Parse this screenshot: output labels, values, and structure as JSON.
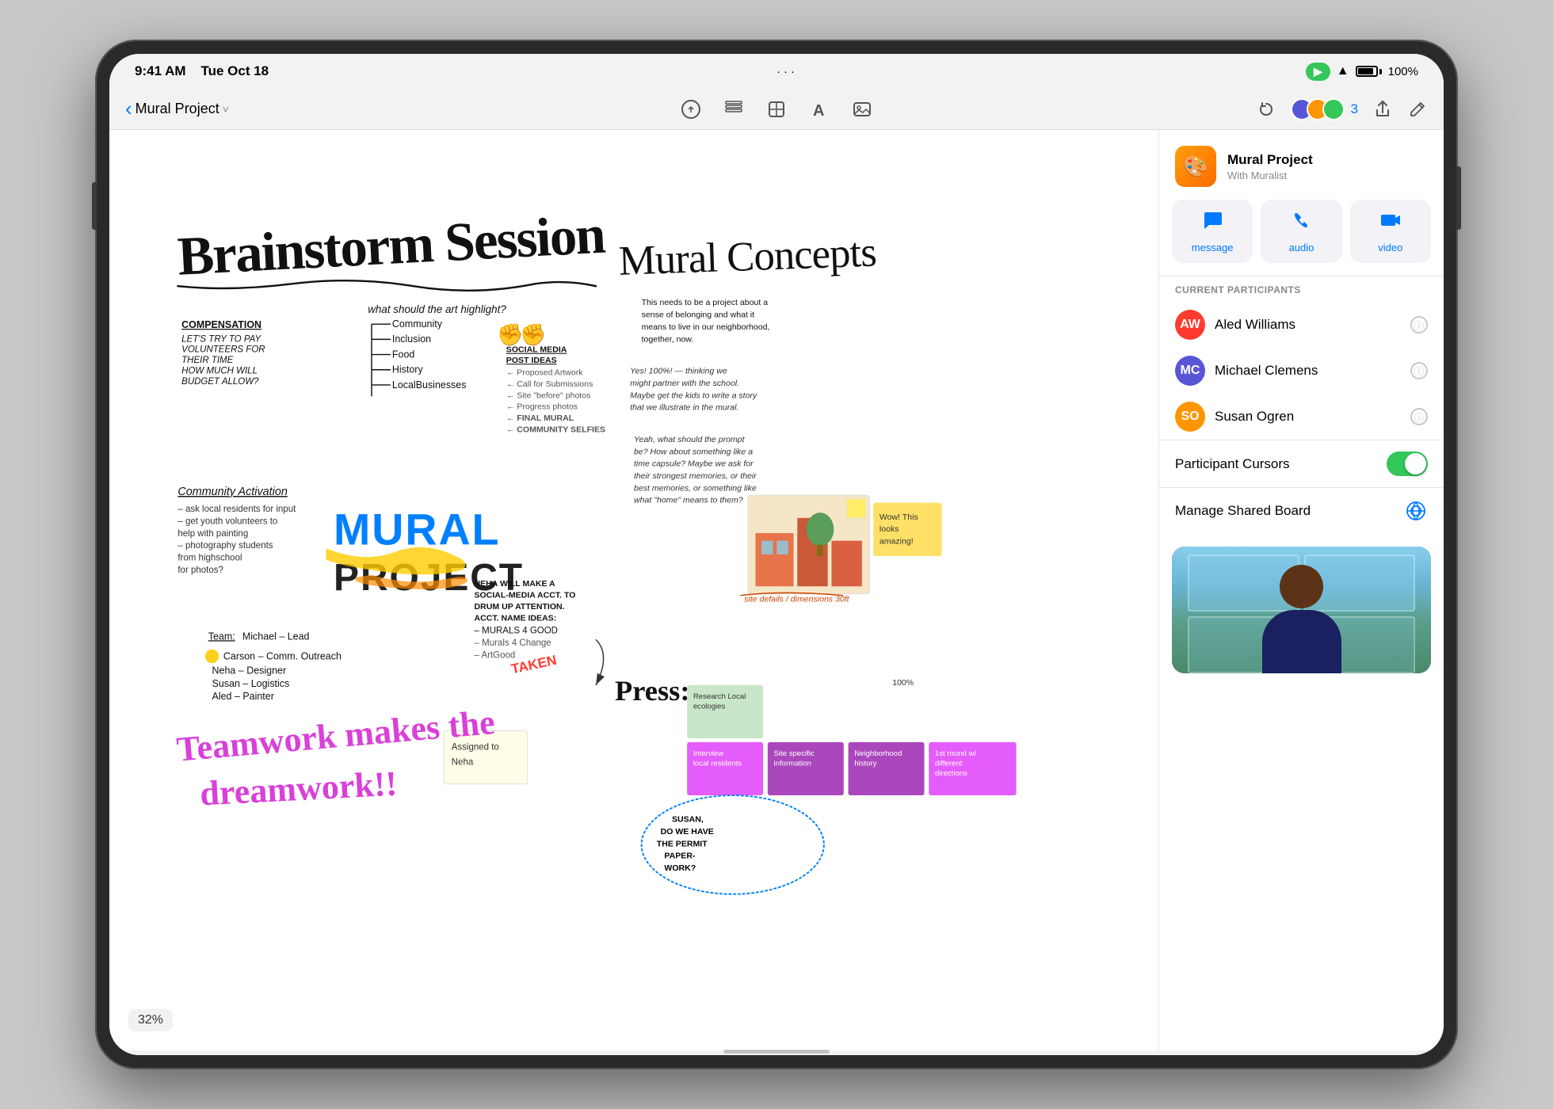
{
  "device": {
    "status_bar": {
      "time": "9:41 AM",
      "date": "Tue Oct 18",
      "dots": "···",
      "facetime_label": "▶",
      "wifi": "WiFi",
      "battery": "100%"
    }
  },
  "toolbar": {
    "back_label": "‹",
    "title": "Mural Project",
    "chevron": "˅",
    "icons": {
      "pencil": "✏",
      "layers": "⊟",
      "shapes": "⬡",
      "text": "A",
      "photo": "⊞"
    },
    "right": {
      "undo": "↩",
      "participants_count": "3",
      "share": "⬆",
      "pencil_edit": "✏"
    }
  },
  "canvas": {
    "zoom": "32%",
    "title1": "Brainstorm Session",
    "title2": "Mural Concepts"
  },
  "side_panel": {
    "app_name": "Mural Project",
    "subtitle": "With Muralist",
    "actions": {
      "message_label": "message",
      "audio_label": "audio",
      "video_label": "video"
    },
    "section_header": "CURRENT PARTICIPANTS",
    "participants": [
      {
        "name": "Aled Williams",
        "initials": "AW",
        "color": "p-avatar-aled"
      },
      {
        "name": "Michael Clemens",
        "initials": "MC",
        "color": "p-avatar-michael"
      },
      {
        "name": "Susan Ogren",
        "initials": "SO",
        "color": "p-avatar-susan"
      }
    ],
    "toggle": {
      "label": "Participant Cursors",
      "on": true
    },
    "manage": {
      "label": "Manage Shared Board"
    }
  }
}
